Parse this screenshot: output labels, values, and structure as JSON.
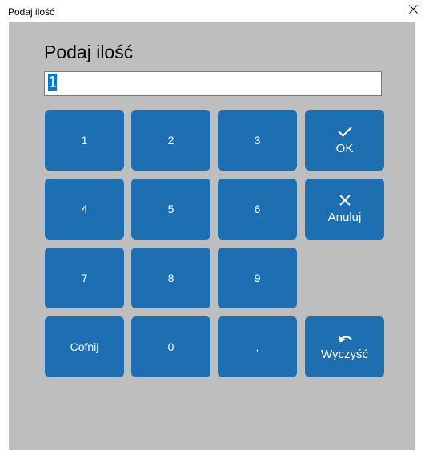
{
  "window": {
    "title": "Podaj ilość",
    "close_glyph": "✕"
  },
  "dialog": {
    "heading": "Podaj ilość",
    "input_value": "1"
  },
  "keypad": {
    "k1": "1",
    "k2": "2",
    "k3": "3",
    "k4": "4",
    "k5": "5",
    "k6": "6",
    "k7": "7",
    "k8": "8",
    "k9": "9",
    "k0": "0",
    "comma": ",",
    "back": "Cofnij",
    "ok": "OK",
    "cancel": "Anuluj",
    "clear": "Wyczyść"
  },
  "icons": {
    "ok": "checkmark-icon",
    "cancel": "x-icon",
    "clear": "undo-icon"
  },
  "colors": {
    "key_bg": "#1e6fb2",
    "panel_bg": "#bebebe",
    "selection": "#0078d7"
  }
}
